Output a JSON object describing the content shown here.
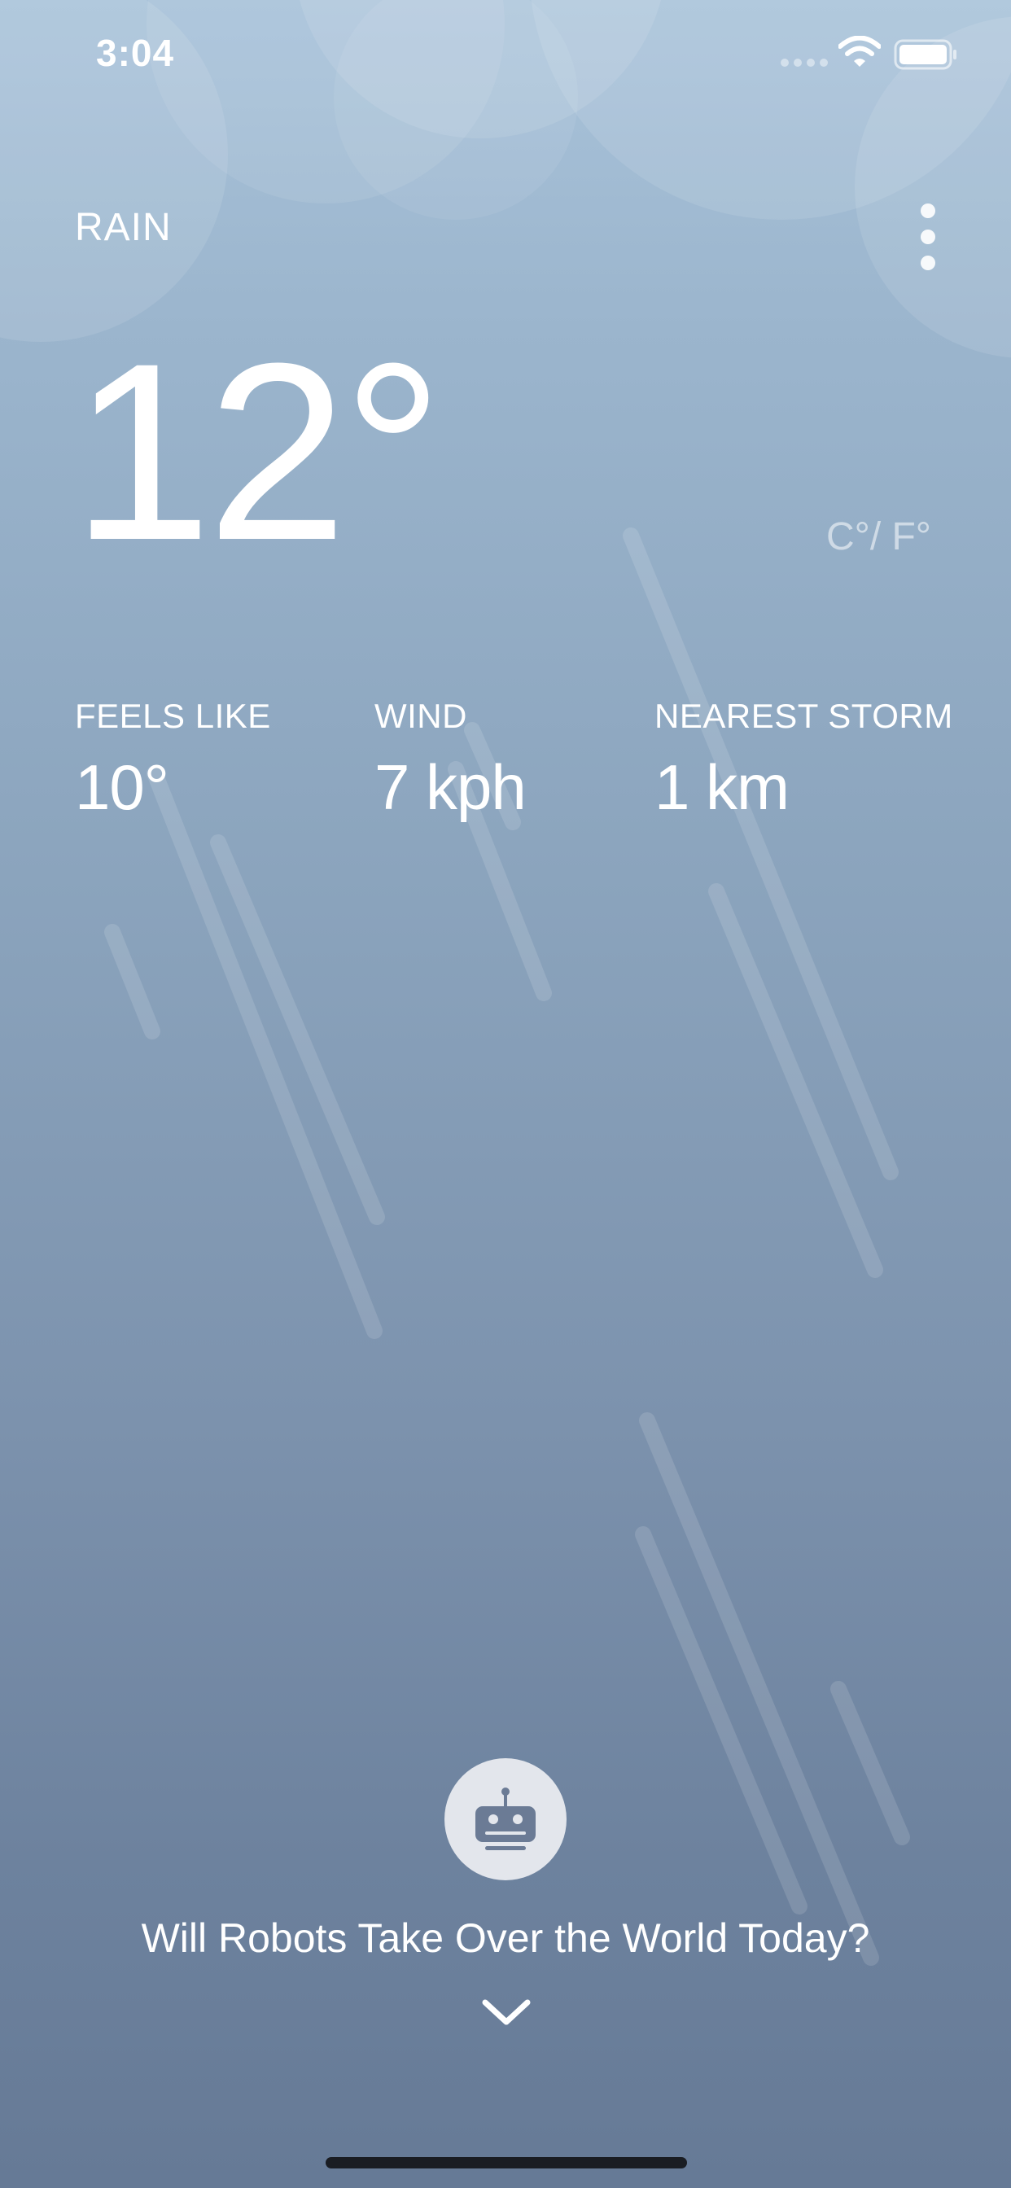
{
  "status_bar": {
    "time": "3:04"
  },
  "weather": {
    "condition": "RAIN",
    "temperature": "12°",
    "unit_toggle": "C°/ F°"
  },
  "metrics": {
    "feels_like": {
      "label": "FEELS LIKE",
      "value": "10°"
    },
    "wind": {
      "label": "WIND",
      "value": "7 kph"
    },
    "nearest_storm": {
      "label": "NEAREST STORM",
      "value": "1 km"
    }
  },
  "robot": {
    "question": "Will Robots Take Over the World Today?"
  },
  "icons": {
    "menu": "more-vertical-icon",
    "robot": "robot-icon",
    "expand": "chevron-down-icon"
  },
  "colors": {
    "background_top": "#a9c3da",
    "background_bottom": "#667a96",
    "text": "#ffffff",
    "robot_button": "#e3e6ec"
  }
}
